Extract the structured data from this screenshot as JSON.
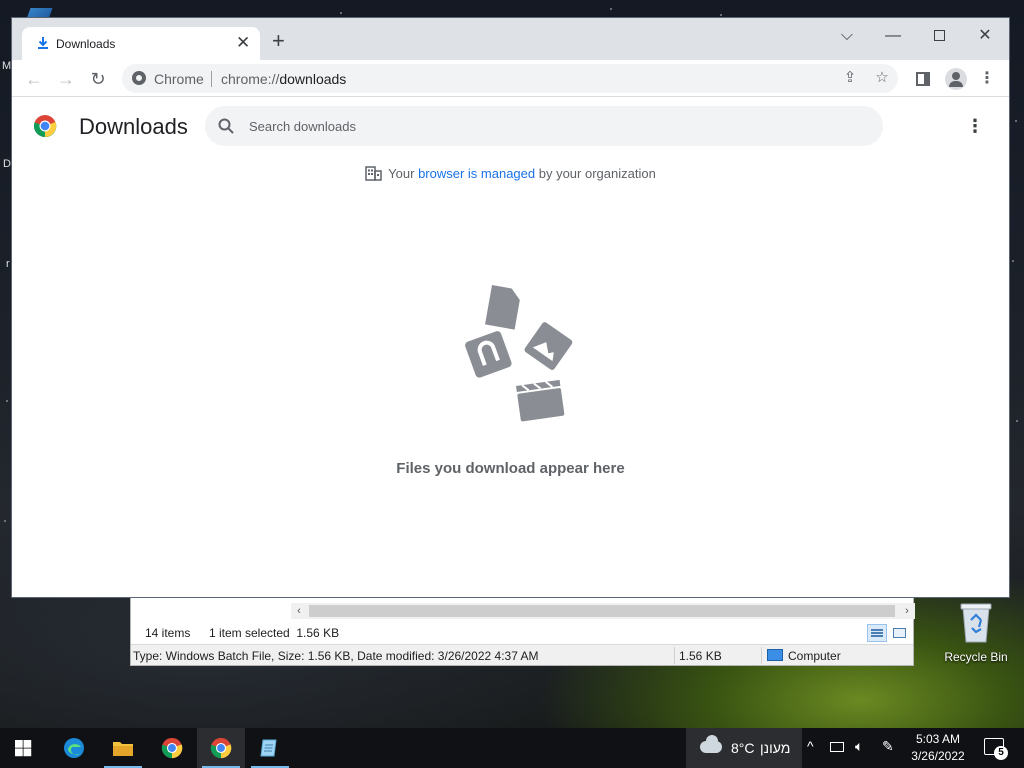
{
  "chrome": {
    "tab": {
      "title": "Downloads",
      "icon": "download-icon"
    },
    "address": {
      "site_name": "Chrome",
      "url_scheme": "chrome://",
      "url_path": "downloads"
    },
    "page": {
      "title": "Downloads",
      "search_placeholder": "Search downloads",
      "managed_prefix": "Your ",
      "managed_link": "browser is managed",
      "managed_suffix": " by your organization",
      "empty_message": "Files you download appear here"
    }
  },
  "explorer": {
    "item_count": "14 items",
    "selection": "1 item selected  1.56 KB",
    "details": "Type: Windows Batch File, Size: 1.56 KB, Date modified: 3/26/2022 4:37 AM",
    "size": "1.56 KB",
    "location": "Computer"
  },
  "desktop": {
    "recycle_bin_label": "Recycle Bin",
    "edge_letters": [
      "M",
      "D",
      "r"
    ]
  },
  "taskbar": {
    "weather_temp": "8°C",
    "weather_condition": "מעונן",
    "time": "5:03 AM",
    "date": "3/26/2022",
    "notification_count": "5"
  },
  "colors": {
    "chrome_accent": "#1a73e8",
    "taskbar_bg": "#101114",
    "taskbar_active_underline": "#76b9ed"
  }
}
